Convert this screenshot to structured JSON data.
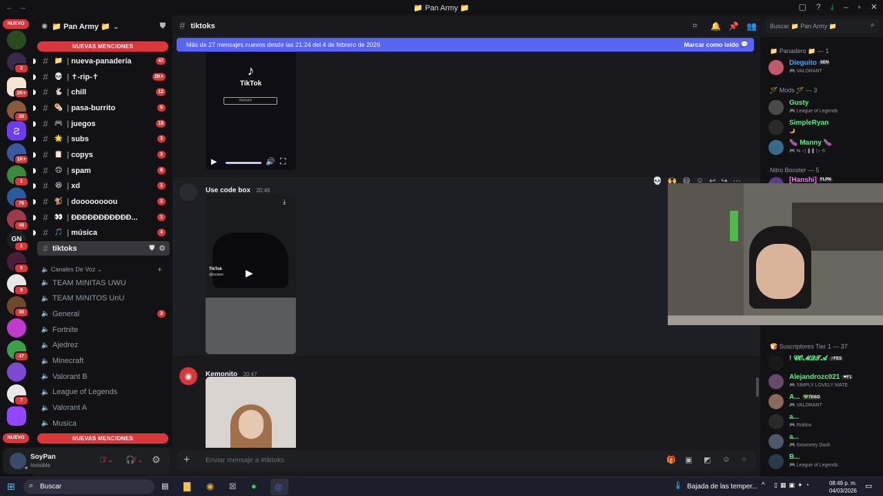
{
  "window": {
    "title": "📁 Pan Army 📁",
    "nav_back": "←",
    "nav_fwd": "→"
  },
  "rail": {
    "new_label": "NUEVO",
    "badges": [
      "2",
      "2K+",
      "20",
      "1K+",
      "1",
      "76",
      "46",
      "1",
      "5",
      "9",
      "30",
      "47",
      "7"
    ],
    "gn_label": "GN",
    "new_label_bottom": "NUEVO"
  },
  "server": {
    "name": "📁 Pan Army 📁",
    "mentions_top": "NUEVAS MENCIONES",
    "mentions_bottom": "NUEVAS MENCIONES"
  },
  "channels": [
    {
      "emoji": "📁",
      "name": "nueva-panadería",
      "badge": "47"
    },
    {
      "emoji": "💀",
      "name": "✝-rip-✝",
      "badge": "2K+"
    },
    {
      "emoji": "🐇",
      "name": "chill",
      "badge": "12"
    },
    {
      "emoji": "🌯",
      "name": "pasa-burrito",
      "badge": "5"
    },
    {
      "emoji": "🎮",
      "name": "juegos",
      "badge": "15"
    },
    {
      "emoji": "🌟",
      "name": "subs",
      "badge": "3"
    },
    {
      "emoji": "📋",
      "name": "copys",
      "badge": "3"
    },
    {
      "emoji": "🙃",
      "name": "spam",
      "badge": "8"
    },
    {
      "emoji": "😆",
      "name": "xd",
      "badge": "1"
    },
    {
      "emoji": "🐒",
      "name": "doooooooou",
      "badge": "2"
    },
    {
      "emoji": "👀",
      "name": "ÐÐÐÐÐÐÐÐÐÐÐ...",
      "badge": "1"
    },
    {
      "emoji": "🎵",
      "name": "música",
      "badge": "4"
    },
    {
      "emoji": "",
      "name": "tiktoks",
      "badge": ""
    }
  ],
  "voice": {
    "category": "Canales De Voz",
    "items": [
      {
        "name": "TEAM MINITAS UWU",
        "badge": ""
      },
      {
        "name": "TEAM MINITOS UnU",
        "badge": ""
      },
      {
        "name": "General",
        "badge": "3"
      },
      {
        "name": "Fortnite",
        "badge": ""
      },
      {
        "name": "Ajedrez",
        "badge": ""
      },
      {
        "name": "Minecraft",
        "badge": ""
      },
      {
        "name": "Valorant B",
        "badge": ""
      },
      {
        "name": "League of Legends",
        "badge": ""
      },
      {
        "name": "Valorant A",
        "badge": ""
      },
      {
        "name": "Musica",
        "badge": ""
      }
    ]
  },
  "user": {
    "name": "SoyPan",
    "status": "Invisible"
  },
  "chat": {
    "channel": "tiktoks",
    "new_msgs": "Más de 27 mensajes nuevos desde las 21:24 del 4 de febrero de 2026",
    "mark_read": "Marcar como leído",
    "tiktok_logo": "TikTok",
    "tiktok_search": "tiktokpln",
    "tiktok_watermark": "TikTok",
    "tiktok_handle": "@luciano",
    "messages": [
      {
        "author": "Use code box",
        "time": "20:46"
      },
      {
        "author": "Kemonito",
        "time": "20:47"
      }
    ],
    "input_placeholder": "Enviar mensaje a #tiktoks"
  },
  "members": {
    "search_placeholder": "Buscar 📁 Pan Army 📁",
    "groups": [
      {
        "title": "📁 Panadero 📁 — 1",
        "members": [
          {
            "name": "Dieguito",
            "tag": "SEN",
            "activity": "🎮 VALORANT",
            "color": "#3ea6ff"
          }
        ]
      },
      {
        "title": "🪄 Mods 🪄 — 3",
        "members": [
          {
            "name": "Gusty",
            "tag": "",
            "activity": "🎮 League of Legends",
            "color": "#57f287"
          },
          {
            "name": "SimpleRyan",
            "tag": "",
            "activity": "🌙",
            "color": "#57f287"
          },
          {
            "name": "🍆 Manny 🍆",
            "tag": "",
            "activity": "🎮 ⇆  ◁  ❚❚  ▷  ⟲",
            "color": "#57f287"
          }
        ]
      },
      {
        "title": "Nitro Booster — 5",
        "members": [
          {
            "name": "[Hanshi]",
            "tag": "FLPN",
            "activity": "",
            "color": "#ff73fa"
          }
        ]
      },
      {
        "title": "🍞 Suscriptores Tier 1 — 37",
        "members": [
          {
            "name": "! 𝓒𝓞𝓜𝓠𝓣𝓐",
            "tag": "⚡FES",
            "activity": "",
            "color": "#57f287"
          },
          {
            "name": "Alejandrozc021",
            "tag": "❤F1",
            "activity": "🎮 SIMPLY LOVELY MATE",
            "color": "#57f287"
          },
          {
            "name": "A...",
            "tag": "💚7DSO",
            "activity": "🎮 VALORANT",
            "color": "#57f287"
          },
          {
            "name": "a...",
            "tag": "",
            "activity": "🎮 Roblox",
            "color": "#57f287"
          },
          {
            "name": "a...",
            "tag": "",
            "activity": "🎮 Geometry Dash",
            "color": "#57f287"
          },
          {
            "name": "B...",
            "tag": "",
            "activity": "🎮 League of Legends",
            "color": "#57f287"
          }
        ]
      }
    ]
  },
  "taskbar": {
    "search": "Buscar",
    "weather": "Bajada de las temper...",
    "time": "08:49 p. m.",
    "date": "04/03/2026"
  },
  "colors": {
    "accent": "#5865f2",
    "danger": "#da373c",
    "bg": "#1a1a1e",
    "rail": "#121214"
  }
}
